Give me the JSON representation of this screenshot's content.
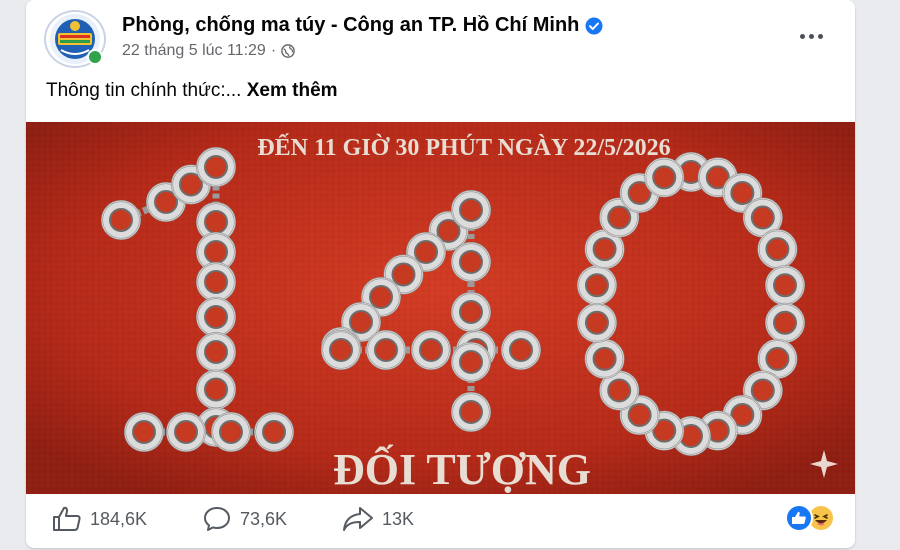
{
  "post": {
    "page_name": "Phòng, chống ma túy - Công an TP. Hồ Chí Minh",
    "timestamp": "22 tháng 5 lúc 11:29",
    "separator": "·",
    "text": "Thông tin chính thức:...",
    "see_more": "Xem thêm"
  },
  "image": {
    "headline": "ĐẾN 11 GIỜ 30 PHÚT NGÀY 22/5/2026",
    "big_number": "140",
    "caption": "ĐỐI TƯỢNG",
    "background_color": "#c2321f",
    "text_color": "#e8ddd2"
  },
  "stats": {
    "likes": "184,6K",
    "comments": "73,6K",
    "shares": "13K"
  },
  "icons": {
    "verified": "verified-badge-icon",
    "privacy": "globe-icon",
    "like": "thumbs-up-icon",
    "comment": "comment-bubble-icon",
    "share": "share-arrow-icon",
    "reaction_like": "like-reaction-icon",
    "reaction_haha": "haha-reaction-icon"
  },
  "colors": {
    "verified": "#1877f2",
    "like_reaction": "#1877f2",
    "haha_reaction": "#f7c34a",
    "secondary_text": "#65676b"
  }
}
